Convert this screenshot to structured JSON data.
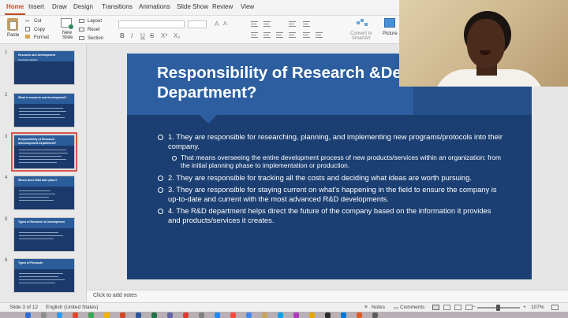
{
  "tabs": [
    "Home",
    "Insert",
    "Draw",
    "Design",
    "Transitions",
    "Animations",
    "Slide Show",
    "Review",
    "View"
  ],
  "ribbon": {
    "paste": "Paste",
    "cut": "Cut",
    "copy": "Copy",
    "format": "Format",
    "new_slide": "New\nSlide",
    "layout": "Layout",
    "reset": "Reset",
    "section": "Section",
    "convert": "Convert to\nSmartArt",
    "picture": "Picture",
    "format_buttons": [
      "B",
      "I",
      "U",
      "S",
      "X²",
      "X₂"
    ]
  },
  "thumbnails": [
    {
      "num": "1",
      "title": "Research and Development",
      "subtitle": "Southwest Athletic"
    },
    {
      "num": "2",
      "title": "What is research and development?"
    },
    {
      "num": "3",
      "title": "Responsibility of Research &Development Department?"
    },
    {
      "num": "4",
      "title": "Where does R&D take place?"
    },
    {
      "num": "5",
      "title": "Types of Research & Development"
    },
    {
      "num": "6",
      "title": "Types of Products"
    }
  ],
  "slide": {
    "title": "Responsibility of Research &Development Department?",
    "bullets": [
      {
        "text": "1. They are responsible for researching, planning, and implementing new programs/protocols into their company.",
        "level": 1
      },
      {
        "text": "That means overseeing the entire development process of new products/services within an organization: from the initial planning phase to implementation or production.",
        "level": 2
      },
      {
        "text": "2. They are responsible for tracking all the costs and deciding what ideas are worth pursuing.",
        "level": 1
      },
      {
        "text": "3. They are responsible  for staying current on what’s happening in the field to ensure  the company is up-to-date and current with the most advanced R&D developments.",
        "level": 1
      },
      {
        "text": "4. The R&D department helps direct the future of the company based on the information it provides and products/services it creates.",
        "level": 1
      }
    ]
  },
  "notes_placeholder": "Click to add notes",
  "status": {
    "slide_of": "Slide 3 of 12",
    "language": "English (United States)",
    "notes": "Notes",
    "comments": "Comments",
    "zoom": "107%"
  },
  "colors": {
    "accent": "#c24a2a",
    "slide_background": "#1b3f72",
    "title_band": "#2d5fa0"
  }
}
